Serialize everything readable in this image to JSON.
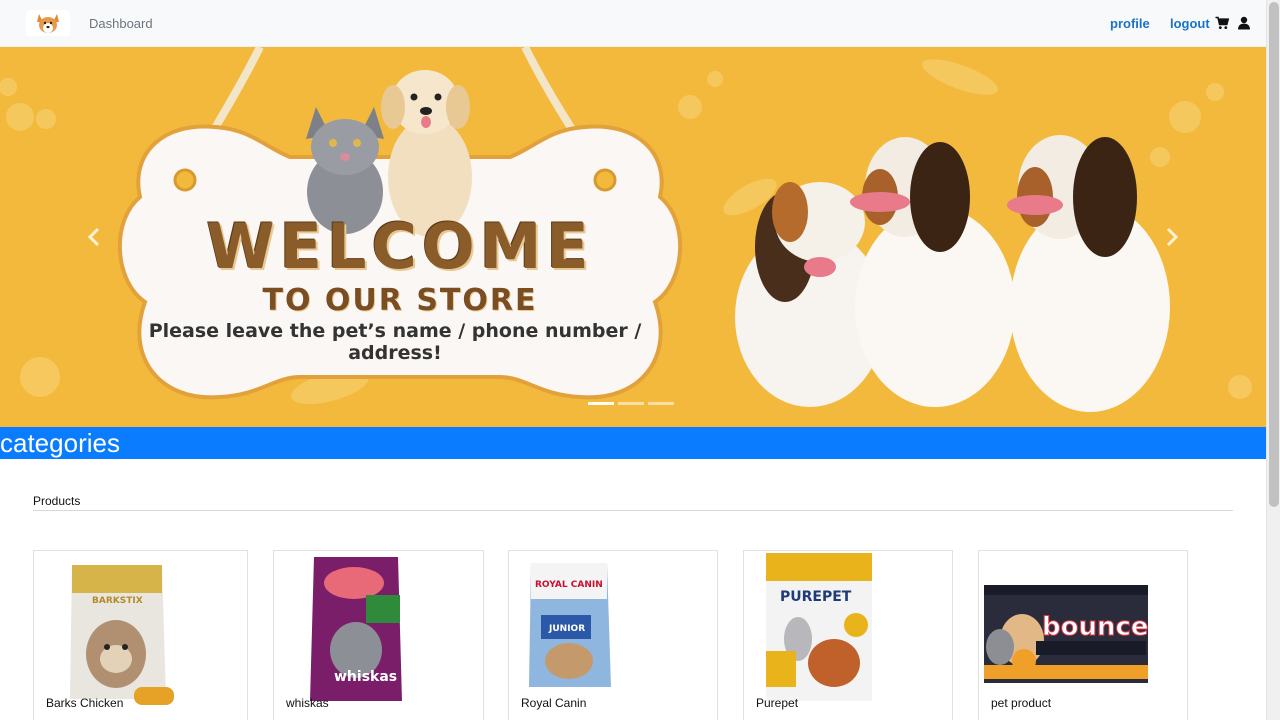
{
  "navbar": {
    "logo_icon": "corgi-logo-icon",
    "dashboard_label": "Dashboard",
    "profile_label": "profile",
    "logout_label": "logout",
    "cart_icon": "shopping-cart-icon",
    "user_icon": "user-icon"
  },
  "carousel": {
    "headline": "WELCOME",
    "subheadline": "TO OUR STORE",
    "tagline": "Please leave the pet’s name / phone number / address!",
    "background_color": "#f2b93d",
    "slide_count": 3,
    "active_slide": 1,
    "prev_icon": "chevron-left-icon",
    "next_icon": "chevron-right-icon"
  },
  "categories": {
    "title": "categories",
    "color": "#0a7cff"
  },
  "products": {
    "section_title": "Products",
    "items": [
      {
        "name": "Barks Chicken"
      },
      {
        "name": "whiskas"
      },
      {
        "name": "Royal Canin"
      },
      {
        "name": "Purepet"
      },
      {
        "name": "pet product"
      }
    ]
  }
}
